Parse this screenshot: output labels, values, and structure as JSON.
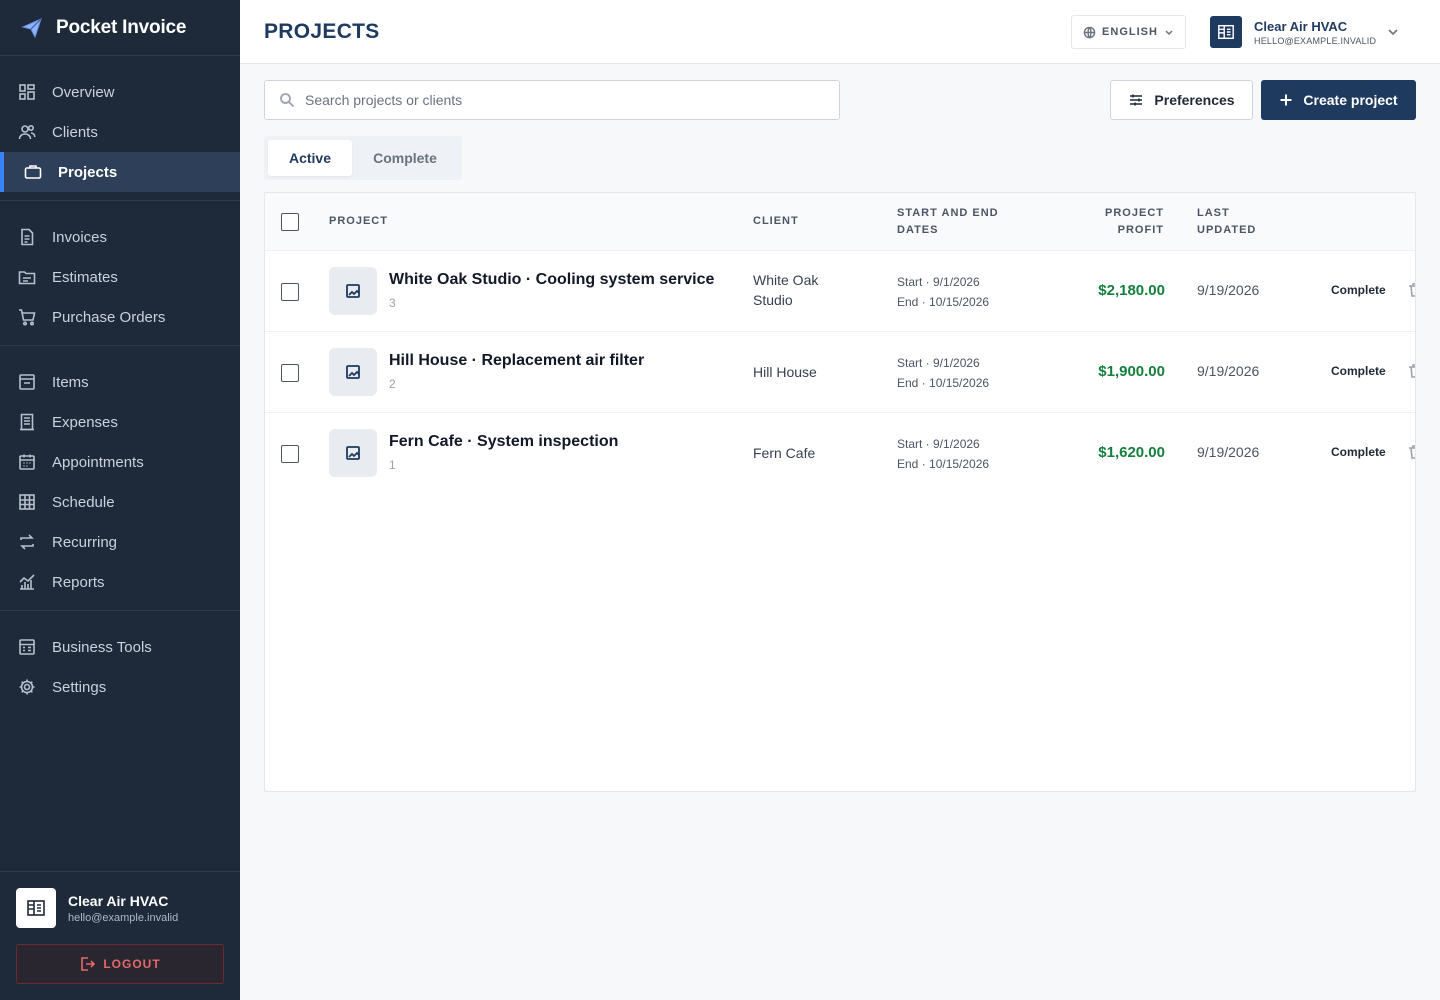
{
  "app": {
    "name": "Pocket Invoice"
  },
  "sidebar": {
    "groups": [
      [
        {
          "label": "Overview",
          "icon": "overview-icon"
        },
        {
          "label": "Clients",
          "icon": "clients-icon"
        },
        {
          "label": "Projects",
          "icon": "briefcase-icon",
          "active": true
        }
      ],
      [
        {
          "label": "Invoices",
          "icon": "invoice-icon"
        },
        {
          "label": "Estimates",
          "icon": "estimate-icon"
        },
        {
          "label": "Purchase Orders",
          "icon": "cart-icon"
        }
      ],
      [
        {
          "label": "Items",
          "icon": "items-icon"
        },
        {
          "label": "Expenses",
          "icon": "expenses-icon"
        },
        {
          "label": "Appointments",
          "icon": "calendar-icon"
        },
        {
          "label": "Schedule",
          "icon": "schedule-icon"
        },
        {
          "label": "Recurring",
          "icon": "recurring-icon"
        },
        {
          "label": "Reports",
          "icon": "reports-icon"
        }
      ],
      [
        {
          "label": "Business Tools",
          "icon": "tools-icon"
        },
        {
          "label": "Settings",
          "icon": "gear-icon"
        }
      ]
    ],
    "account": {
      "name": "Clear Air HVAC",
      "email": "hello@example.invalid"
    },
    "logout_label": "LOGOUT"
  },
  "header": {
    "title": "PROJECTS",
    "language": "ENGLISH",
    "account_name": "Clear Air HVAC",
    "account_email": "HELLO@EXAMPLE.INVALID"
  },
  "toolbar": {
    "search_placeholder": "Search projects or clients",
    "preferences_label": "Preferences",
    "create_label": "Create project"
  },
  "tabs": [
    {
      "label": "Active",
      "active": true
    },
    {
      "label": "Complete",
      "active": false
    }
  ],
  "table": {
    "columns": {
      "project": "PROJECT",
      "client": "CLIENT",
      "dates_line1": "START AND END",
      "dates_line2": "DATES",
      "profit_line1": "PROJECT",
      "profit_line2": "PROFIT",
      "updated_line1": "LAST",
      "updated_line2": "UPDATED"
    },
    "rows": [
      {
        "name": "White Oak Studio · Cooling system service",
        "count": "3",
        "client_line1": "White Oak",
        "client_line2": "Studio",
        "start": "Start · 9/1/2026",
        "end": "End · 10/15/2026",
        "profit": "$2,180.00",
        "updated": "9/19/2026",
        "action": "Complete"
      },
      {
        "name": "Hill House · Replacement air filter",
        "count": "2",
        "client_line1": "Hill House",
        "client_line2": "",
        "start": "Start · 9/1/2026",
        "end": "End · 10/15/2026",
        "profit": "$1,900.00",
        "updated": "9/19/2026",
        "action": "Complete"
      },
      {
        "name": "Fern Cafe · System inspection",
        "count": "1",
        "client_line1": "Fern Cafe",
        "client_line2": "",
        "start": "Start · 9/1/2026",
        "end": "End · 10/15/2026",
        "profit": "$1,620.00",
        "updated": "9/19/2026",
        "action": "Complete"
      }
    ]
  },
  "colors": {
    "sidebar_bg": "#1e2a3a",
    "accent": "#1e3a5f",
    "profit": "#15803d",
    "logout": "#e46a6a"
  }
}
